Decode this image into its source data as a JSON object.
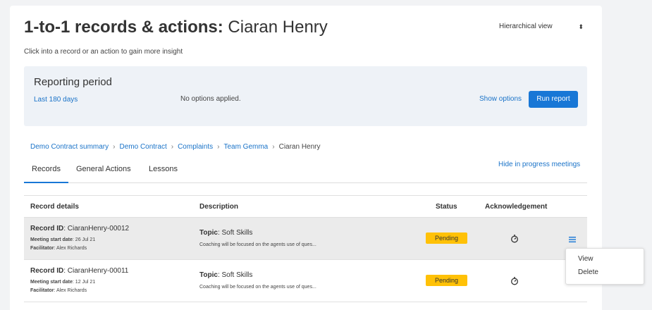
{
  "header": {
    "title_bold": "1-to-1 records & actions:",
    "title_name": "Ciaran Henry",
    "subtitle": "Click into a record or an action to gain more insight",
    "view_select": "Hierarchical view"
  },
  "reporting": {
    "heading": "Reporting period",
    "period": "Last 180 days",
    "options_status": "No options applied.",
    "show_options": "Show options",
    "run_report": "Run report"
  },
  "breadcrumb": [
    "Demo Contract summary",
    "Demo Contract",
    "Complaints",
    "Team Gemma",
    "Ciaran Henry"
  ],
  "tabs": [
    "Records",
    "General Actions",
    "Lessons"
  ],
  "hide_in_progress": "Hide in progress meetings",
  "table": {
    "headers": [
      "Record details",
      "Description",
      "Status",
      "Acknowledgement"
    ],
    "labels": {
      "record_id": "Record ID",
      "meeting_start": "Meeting start date",
      "facilitator": "Facilitator",
      "topic": "Topic"
    },
    "rows": [
      {
        "record_id": "CiaranHenry-00012",
        "meeting_start": "26 Jul 21",
        "facilitator": "Alex Richards",
        "topic": "Soft Skills",
        "description": "Coaching will be focused on the agents use of ques...",
        "status": "Pending"
      },
      {
        "record_id": "CiaranHenry-00011",
        "meeting_start": "12 Jul 21",
        "facilitator": "Alex Richards",
        "topic": "Soft Skills",
        "description": "Coaching will be focused on the agents use of ques...",
        "status": "Pending"
      }
    ]
  },
  "row_menu": [
    "View",
    "Delete"
  ],
  "colors": {
    "accent": "#1877d6",
    "link": "#1a73c8",
    "pending": "#ffc107"
  },
  "icons": {
    "acknowledgement": "timer-icon",
    "row_actions": "hamburger-menu-icon",
    "select_arrow": "sort-arrows-icon"
  }
}
